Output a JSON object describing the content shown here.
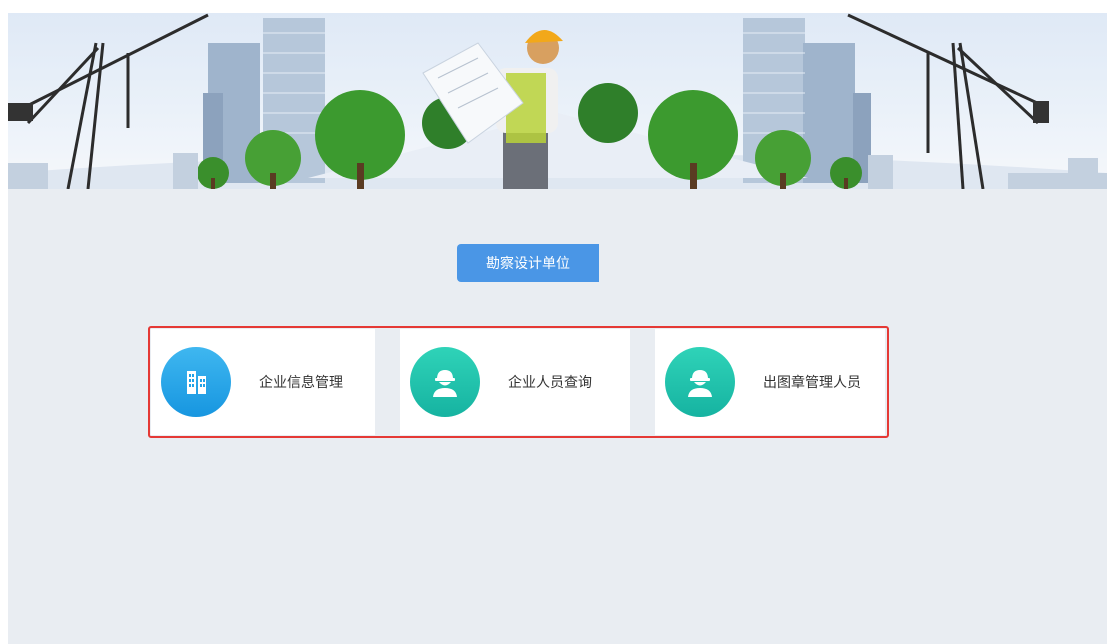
{
  "section": {
    "title": "勘察设计单位"
  },
  "cards": [
    {
      "label": "企业信息管理",
      "icon": "building-icon",
      "color": "#1fa3e8"
    },
    {
      "label": "企业人员查询",
      "icon": "worker-helmet-icon",
      "color": "#1cc0a8"
    },
    {
      "label": "出图章管理人员",
      "icon": "worker-helmet-icon",
      "color": "#1cc0a8"
    }
  ],
  "colors": {
    "accent": "#4a96e6",
    "highlight_border": "#e53935",
    "background": "#e9edf2"
  }
}
